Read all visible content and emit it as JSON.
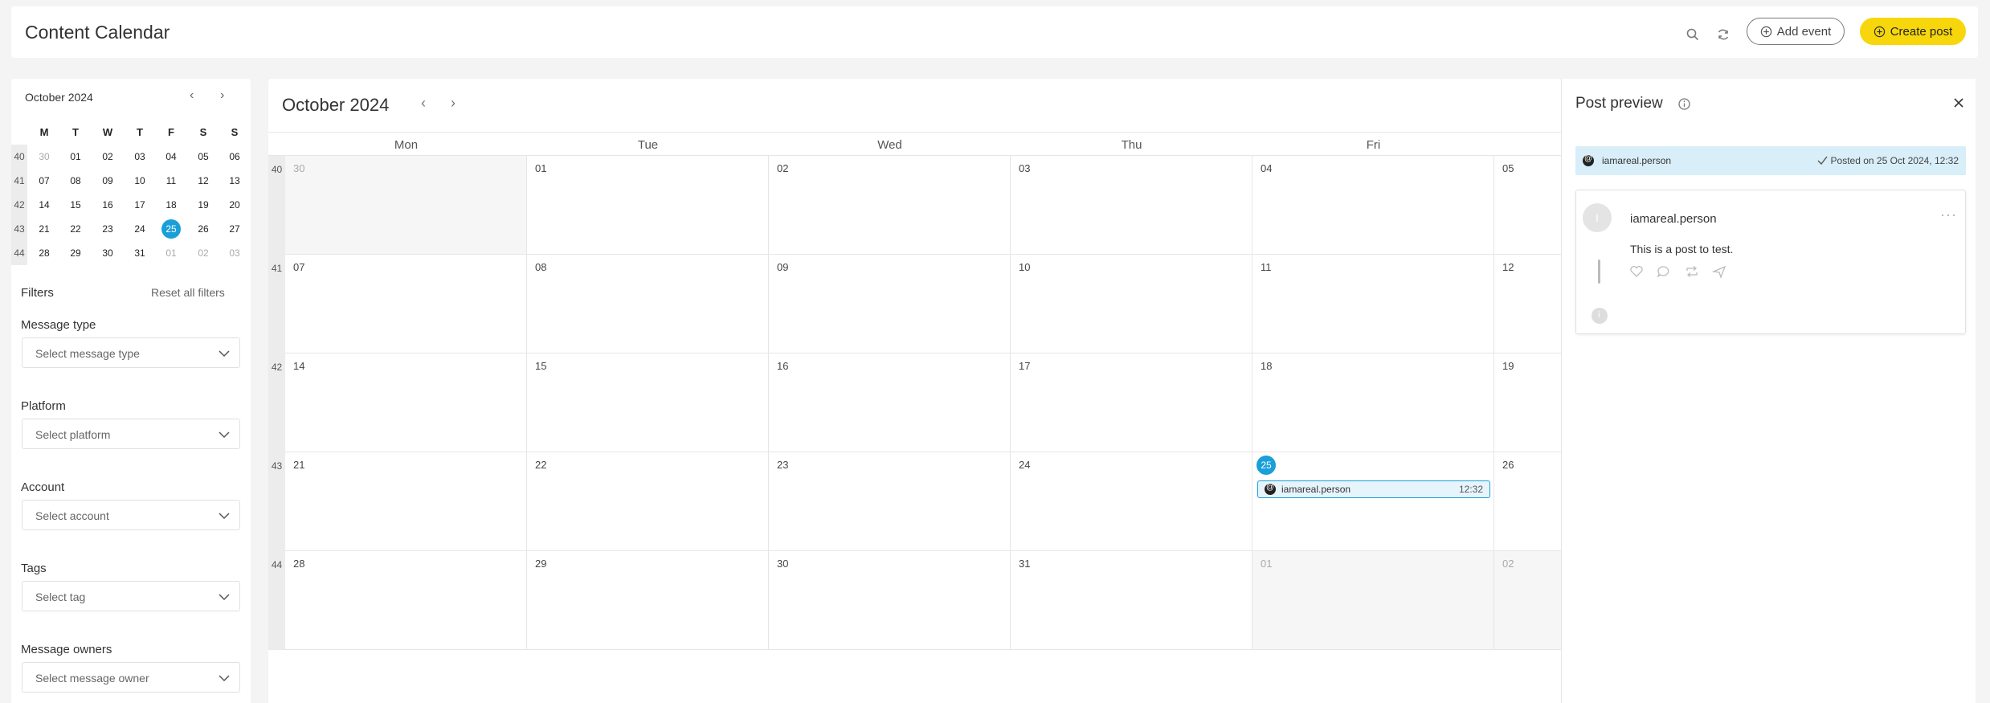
{
  "header": {
    "title": "Content Calendar",
    "add_event_label": "Add event",
    "create_post_label": "Create post",
    "accent_color": "#f7d70c"
  },
  "sidebar": {
    "mini_calendar": {
      "month_label": "October 2024",
      "weekday_headers": [
        "M",
        "T",
        "W",
        "T",
        "F",
        "S",
        "S"
      ],
      "weeks": [
        {
          "num": "40",
          "days": [
            "30",
            "01",
            "02",
            "03",
            "04",
            "05",
            "06"
          ]
        },
        {
          "num": "41",
          "days": [
            "07",
            "08",
            "09",
            "10",
            "11",
            "12",
            "13"
          ]
        },
        {
          "num": "42",
          "days": [
            "14",
            "15",
            "16",
            "17",
            "18",
            "19",
            "20"
          ]
        },
        {
          "num": "43",
          "days": [
            "21",
            "22",
            "23",
            "24",
            "25",
            "26",
            "27"
          ]
        },
        {
          "num": "44",
          "days": [
            "28",
            "29",
            "30",
            "31",
            "01",
            "02",
            "03"
          ]
        }
      ],
      "today": "25"
    },
    "filters": {
      "title": "Filters",
      "reset_label": "Reset all filters",
      "message_type": {
        "label": "Message type",
        "placeholder": "Select message type"
      },
      "platform": {
        "label": "Platform",
        "placeholder": "Select platform"
      },
      "account": {
        "label": "Account",
        "placeholder": "Select account"
      },
      "tags": {
        "label": "Tags",
        "placeholder": "Select tag"
      },
      "message_owners": {
        "label": "Message owners",
        "placeholder": "Select message owner"
      }
    }
  },
  "calendar": {
    "month_label": "October 2024",
    "weekdays": [
      "Mon",
      "Tue",
      "Wed",
      "Thu",
      "Fri"
    ],
    "weeks": [
      {
        "num": "40",
        "days": [
          "30",
          "01",
          "02",
          "03",
          "04",
          "05"
        ]
      },
      {
        "num": "41",
        "days": [
          "07",
          "08",
          "09",
          "10",
          "11",
          "12"
        ]
      },
      {
        "num": "42",
        "days": [
          "14",
          "15",
          "16",
          "17",
          "18",
          "19"
        ]
      },
      {
        "num": "43",
        "days": [
          "21",
          "22",
          "23",
          "24",
          "25",
          "26"
        ]
      },
      {
        "num": "44",
        "days": [
          "28",
          "29",
          "30",
          "31",
          "01",
          "02"
        ]
      }
    ],
    "today": "25",
    "event": {
      "account": "iamareal.person",
      "time": "12:32"
    },
    "today_color": "#1a9fd8"
  },
  "preview": {
    "title": "Post preview",
    "status_account": "iamareal.person",
    "status_text": "Posted on 25 Oct 2024, 12:32",
    "avatar_initial": "I",
    "post_account": "iamareal.person",
    "post_text": "This is a post to test.",
    "more_glyph": "···"
  }
}
